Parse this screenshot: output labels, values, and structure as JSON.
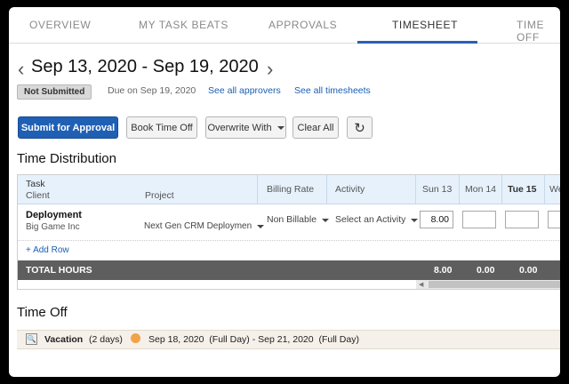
{
  "tabs": [
    "OVERVIEW",
    "MY TASK BEATS",
    "APPROVALS",
    "TIMESHEET",
    "TIME OFF"
  ],
  "active_tab": "TIMESHEET",
  "period": {
    "range": "Sep 13, 2020 - Sep 19, 2020",
    "prev_icon": "chevron-left-icon",
    "next_icon": "chevron-right-icon"
  },
  "status": {
    "badge": "Not Submitted",
    "due": "Due on Sep 19, 2020",
    "approvers_link": "See all approvers",
    "timesheets_link": "See all timesheets"
  },
  "toolbar": {
    "submit": "Submit for Approval",
    "book_time_off": "Book Time Off",
    "overwrite": "Overwrite With",
    "clear_all": "Clear All",
    "refresh_icon": "refresh-icon"
  },
  "distribution": {
    "title": "Time Distribution",
    "headers": {
      "task": "Task",
      "client": "Client",
      "project": "Project",
      "billing_rate": "Billing Rate",
      "activity": "Activity",
      "days": [
        "Sun 13",
        "Mon 14",
        "Tue 15",
        "We"
      ]
    },
    "rows": [
      {
        "task": "Deployment",
        "client": "Big Game Inc",
        "project": "Next Gen CRM Deploymen",
        "billing": "Non Billable",
        "activity": "Select an Activity",
        "hours": [
          "8.00",
          "",
          "",
          ""
        ]
      }
    ],
    "add_row": "+ Add Row",
    "total_label": "TOTAL HOURS",
    "totals": [
      "8.00",
      "0.00",
      "0.00"
    ]
  },
  "time_off": {
    "title": "Time Off",
    "type": "Vacation",
    "duration": "(2 days)",
    "range": "Sep 18, 2020  (Full Day) - Sep 21, 2020  (Full Day)"
  },
  "colors": {
    "accent": "#2b5fb3",
    "primary_button": "#1f60b5",
    "header_bg": "#e6f1fb",
    "total_bg": "#5e5e5e"
  }
}
